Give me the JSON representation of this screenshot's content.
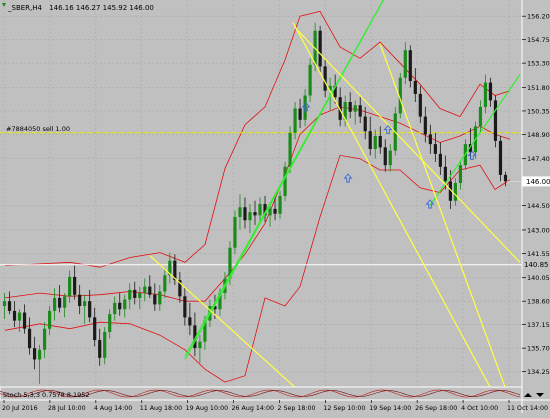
{
  "window": {
    "title": "_SBER,H4",
    "ohlc": "146.16 146.27 145.92 146.00"
  },
  "colors": {
    "background": "#c0c0c0",
    "grid": "#a9a9a9",
    "bull": "#1a8a1a",
    "bear": "#1a1a1a",
    "bollinger": "#e01010",
    "trend_yellow": "#ffff40",
    "trend_green": "#33ee33",
    "order_line": "#e8e800",
    "level_line": "#ffffff",
    "arrows": "#3a6ad6",
    "current_price_bg": "#ffffff"
  },
  "annotations": {
    "order_label": "#7884050 sell 1.00",
    "indicator_label": "Stoch 5,3,3 0.7578 8.1952"
  },
  "chart_data": {
    "type": "candlestick",
    "symbol": "_SBER",
    "timeframe": "H4",
    "ylim": [
      133.3,
      157.2
    ],
    "y_ticks": [
      {
        "value": 156.2,
        "label": "156.20"
      },
      {
        "value": 154.75,
        "label": "154.75"
      },
      {
        "value": 153.3,
        "label": "153.30"
      },
      {
        "value": 151.8,
        "label": "151.80"
      },
      {
        "value": 150.35,
        "label": "150.35"
      },
      {
        "value": 148.9,
        "label": "148.90"
      },
      {
        "value": 147.4,
        "label": "147.40"
      },
      {
        "value": 144.5,
        "label": "144.50"
      },
      {
        "value": 143.0,
        "label": "143.00"
      },
      {
        "value": 141.55,
        "label": "141.55"
      },
      {
        "value": 140.05,
        "label": "140.05"
      },
      {
        "value": 138.6,
        "label": "138.60"
      },
      {
        "value": 137.15,
        "label": "137.15"
      },
      {
        "value": 135.7,
        "label": "135.70"
      },
      {
        "value": 134.25,
        "label": "134.25"
      },
      {
        "value": 132.8,
        "label": "132.80"
      }
    ],
    "x_ticks": [
      "20 Jul 2016",
      "28 Jul 10:00",
      "4 Aug 14:00",
      "11 Aug 18:00",
      "19 Aug 10:00",
      "26 Aug 14:00",
      "2 Sep 18:00",
      "12 Sep 10:00",
      "19 Sep 14:00",
      "26 Sep 18:00",
      "4 Oct 10:00",
      "11 Oct 14:00"
    ],
    "current_price": {
      "value": 146.0,
      "label": "146.00"
    },
    "level_line": {
      "value": 140.85,
      "label": "140.85"
    },
    "order_line": {
      "value": 149.0
    },
    "bollinger": {
      "upper": [
        [
          5,
          140.8
        ],
        [
          40,
          140.9
        ],
        [
          70,
          141.0
        ],
        [
          100,
          140.7
        ],
        [
          130,
          141.3
        ],
        [
          160,
          141.6
        ],
        [
          185,
          141.0
        ],
        [
          205,
          142.1
        ],
        [
          225,
          146.8
        ],
        [
          245,
          149.5
        ],
        [
          265,
          150.6
        ],
        [
          285,
          153.5
        ],
        [
          300,
          156.2
        ],
        [
          320,
          156.5
        ],
        [
          340,
          154.3
        ],
        [
          360,
          153.6
        ],
        [
          380,
          154.6
        ],
        [
          400,
          153.3
        ],
        [
          420,
          152.0
        ],
        [
          440,
          150.5
        ],
        [
          460,
          150.0
        ],
        [
          480,
          152.0
        ],
        [
          495,
          151.3
        ],
        [
          510,
          151.6
        ]
      ],
      "middle": [
        [
          5,
          138.8
        ],
        [
          40,
          139.1
        ],
        [
          70,
          138.9
        ],
        [
          100,
          139.0
        ],
        [
          130,
          139.2
        ],
        [
          160,
          139.0
        ],
        [
          185,
          138.6
        ],
        [
          205,
          138.6
        ],
        [
          225,
          140.0
        ],
        [
          245,
          141.5
        ],
        [
          265,
          143.4
        ],
        [
          285,
          146.4
        ],
        [
          300,
          148.9
        ],
        [
          320,
          150.1
        ],
        [
          340,
          150.6
        ],
        [
          360,
          150.4
        ],
        [
          380,
          150.0
        ],
        [
          400,
          149.6
        ],
        [
          420,
          149.0
        ],
        [
          440,
          148.4
        ],
        [
          460,
          148.8
        ],
        [
          480,
          149.4
        ],
        [
          495,
          148.9
        ],
        [
          510,
          148.6
        ]
      ],
      "lower": [
        [
          5,
          136.8
        ],
        [
          40,
          137.2
        ],
        [
          70,
          136.9
        ],
        [
          100,
          137.3
        ],
        [
          130,
          137.2
        ],
        [
          160,
          136.5
        ],
        [
          185,
          135.6
        ],
        [
          205,
          134.4
        ],
        [
          225,
          133.6
        ],
        [
          245,
          134.0
        ],
        [
          265,
          138.8
        ],
        [
          285,
          138.3
        ],
        [
          300,
          139.5
        ],
        [
          320,
          143.8
        ],
        [
          340,
          147.6
        ],
        [
          360,
          147.4
        ],
        [
          380,
          146.7
        ],
        [
          400,
          146.7
        ],
        [
          420,
          145.6
        ],
        [
          440,
          145.3
        ],
        [
          460,
          146.7
        ],
        [
          480,
          147.0
        ],
        [
          495,
          145.5
        ],
        [
          510,
          146.1
        ]
      ]
    },
    "trendlines": [
      {
        "color": "green",
        "x1": 185,
        "y1": 135.2,
        "x2": 395,
        "y2": 158.5
      },
      {
        "color": "green",
        "x1": 185,
        "y1": 135.0,
        "x2": 395,
        "y2": 158.5
      },
      {
        "color": "green",
        "x1": 430,
        "y1": 144.5,
        "x2": 520,
        "y2": 152.6
      },
      {
        "color": "yellow",
        "x1": 150,
        "y1": 141.4,
        "x2": 300,
        "y2": 133.0
      },
      {
        "color": "yellow",
        "x1": 293,
        "y1": 155.8,
        "x2": 490,
        "y2": 133.3
      },
      {
        "color": "yellow",
        "x1": 295,
        "y1": 155.5,
        "x2": 520,
        "y2": 141.0
      },
      {
        "color": "yellow",
        "x1": 380,
        "y1": 154.5,
        "x2": 505,
        "y2": 133.3
      }
    ],
    "arrows": [
      {
        "x": 306,
        "y": 150.6
      },
      {
        "x": 348,
        "y": 146.2
      },
      {
        "x": 388,
        "y": 149.2
      },
      {
        "x": 430,
        "y": 144.6
      },
      {
        "x": 472,
        "y": 147.6
      }
    ],
    "candles": [
      {
        "o": 138.3,
        "h": 139.1,
        "l": 137.5,
        "c": 138.6
      },
      {
        "o": 138.6,
        "h": 139.2,
        "l": 137.8,
        "c": 138.0
      },
      {
        "o": 138.0,
        "h": 138.6,
        "l": 137.0,
        "c": 137.4
      },
      {
        "o": 137.4,
        "h": 138.1,
        "l": 136.7,
        "c": 137.9
      },
      {
        "o": 137.9,
        "h": 138.4,
        "l": 136.6,
        "c": 136.9
      },
      {
        "o": 136.9,
        "h": 137.6,
        "l": 135.3,
        "c": 135.7
      },
      {
        "o": 135.7,
        "h": 136.4,
        "l": 134.4,
        "c": 135.0
      },
      {
        "o": 135.0,
        "h": 135.9,
        "l": 133.5,
        "c": 135.6
      },
      {
        "o": 135.6,
        "h": 137.3,
        "l": 135.1,
        "c": 136.9
      },
      {
        "o": 136.9,
        "h": 138.3,
        "l": 136.5,
        "c": 138.0
      },
      {
        "o": 138.0,
        "h": 139.4,
        "l": 137.4,
        "c": 138.8
      },
      {
        "o": 138.8,
        "h": 139.6,
        "l": 137.9,
        "c": 138.2
      },
      {
        "o": 138.2,
        "h": 139.1,
        "l": 137.6,
        "c": 138.9
      },
      {
        "o": 138.9,
        "h": 140.5,
        "l": 138.5,
        "c": 140.1
      },
      {
        "o": 140.1,
        "h": 140.8,
        "l": 138.7,
        "c": 139.0
      },
      {
        "o": 139.0,
        "h": 139.6,
        "l": 137.8,
        "c": 138.3
      },
      {
        "o": 138.3,
        "h": 139.0,
        "l": 137.2,
        "c": 138.6
      },
      {
        "o": 138.6,
        "h": 139.3,
        "l": 137.3,
        "c": 137.6
      },
      {
        "o": 137.6,
        "h": 138.2,
        "l": 135.8,
        "c": 136.2
      },
      {
        "o": 136.2,
        "h": 136.9,
        "l": 134.6,
        "c": 135.1
      },
      {
        "o": 135.1,
        "h": 137.0,
        "l": 134.7,
        "c": 136.7
      },
      {
        "o": 136.7,
        "h": 138.1,
        "l": 136.3,
        "c": 137.8
      },
      {
        "o": 137.8,
        "h": 138.9,
        "l": 137.4,
        "c": 138.5
      },
      {
        "o": 138.5,
        "h": 139.1,
        "l": 137.7,
        "c": 138.1
      },
      {
        "o": 138.1,
        "h": 139.0,
        "l": 137.6,
        "c": 138.7
      },
      {
        "o": 138.7,
        "h": 139.7,
        "l": 138.1,
        "c": 139.3
      },
      {
        "o": 139.3,
        "h": 139.8,
        "l": 138.4,
        "c": 138.8
      },
      {
        "o": 138.8,
        "h": 139.5,
        "l": 138.1,
        "c": 139.1
      },
      {
        "o": 139.1,
        "h": 140.0,
        "l": 138.6,
        "c": 139.5
      },
      {
        "o": 139.5,
        "h": 140.2,
        "l": 138.8,
        "c": 139.0
      },
      {
        "o": 139.0,
        "h": 139.7,
        "l": 138.0,
        "c": 138.4
      },
      {
        "o": 138.4,
        "h": 139.6,
        "l": 138.0,
        "c": 139.2
      },
      {
        "o": 139.2,
        "h": 140.6,
        "l": 138.8,
        "c": 140.2
      },
      {
        "o": 140.2,
        "h": 141.6,
        "l": 139.7,
        "c": 141.1
      },
      {
        "o": 141.1,
        "h": 141.5,
        "l": 139.6,
        "c": 139.9
      },
      {
        "o": 139.9,
        "h": 140.4,
        "l": 138.5,
        "c": 138.9
      },
      {
        "o": 138.9,
        "h": 139.5,
        "l": 137.1,
        "c": 137.6
      },
      {
        "o": 137.6,
        "h": 138.5,
        "l": 136.5,
        "c": 137.1
      },
      {
        "o": 137.1,
        "h": 137.9,
        "l": 135.2,
        "c": 135.7
      },
      {
        "o": 135.7,
        "h": 136.5,
        "l": 134.8,
        "c": 136.1
      },
      {
        "o": 136.1,
        "h": 137.7,
        "l": 135.6,
        "c": 137.4
      },
      {
        "o": 137.4,
        "h": 138.7,
        "l": 137.0,
        "c": 138.3
      },
      {
        "o": 138.3,
        "h": 139.0,
        "l": 137.5,
        "c": 138.1
      },
      {
        "o": 138.1,
        "h": 139.4,
        "l": 137.7,
        "c": 139.1
      },
      {
        "o": 139.1,
        "h": 140.4,
        "l": 138.7,
        "c": 140.0
      },
      {
        "o": 140.0,
        "h": 142.3,
        "l": 139.6,
        "c": 141.9
      },
      {
        "o": 141.9,
        "h": 144.2,
        "l": 141.5,
        "c": 143.8
      },
      {
        "o": 143.8,
        "h": 145.2,
        "l": 143.0,
        "c": 144.4
      },
      {
        "o": 144.4,
        "h": 145.0,
        "l": 143.1,
        "c": 143.6
      },
      {
        "o": 143.6,
        "h": 144.6,
        "l": 142.8,
        "c": 144.1
      },
      {
        "o": 144.1,
        "h": 144.8,
        "l": 143.3,
        "c": 143.9
      },
      {
        "o": 143.9,
        "h": 145.0,
        "l": 143.4,
        "c": 144.6
      },
      {
        "o": 144.6,
        "h": 145.1,
        "l": 143.5,
        "c": 143.9
      },
      {
        "o": 143.9,
        "h": 144.7,
        "l": 143.2,
        "c": 144.3
      },
      {
        "o": 144.3,
        "h": 145.0,
        "l": 143.6,
        "c": 144.0
      },
      {
        "o": 144.0,
        "h": 145.4,
        "l": 143.7,
        "c": 145.1
      },
      {
        "o": 145.1,
        "h": 147.2,
        "l": 144.8,
        "c": 146.9
      },
      {
        "o": 146.9,
        "h": 149.4,
        "l": 146.5,
        "c": 149.0
      },
      {
        "o": 149.0,
        "h": 150.9,
        "l": 148.6,
        "c": 150.5
      },
      {
        "o": 150.5,
        "h": 151.1,
        "l": 149.3,
        "c": 149.8
      },
      {
        "o": 149.8,
        "h": 151.7,
        "l": 149.4,
        "c": 151.3
      },
      {
        "o": 151.3,
        "h": 153.6,
        "l": 150.9,
        "c": 153.2
      },
      {
        "o": 153.2,
        "h": 155.8,
        "l": 152.8,
        "c": 155.3
      },
      {
        "o": 155.3,
        "h": 155.6,
        "l": 152.7,
        "c": 153.1
      },
      {
        "o": 153.1,
        "h": 153.5,
        "l": 151.2,
        "c": 151.6
      },
      {
        "o": 151.6,
        "h": 152.4,
        "l": 150.4,
        "c": 151.9
      },
      {
        "o": 151.9,
        "h": 152.6,
        "l": 150.8,
        "c": 151.2
      },
      {
        "o": 151.2,
        "h": 151.8,
        "l": 149.4,
        "c": 149.8
      },
      {
        "o": 149.8,
        "h": 151.3,
        "l": 149.4,
        "c": 150.9
      },
      {
        "o": 150.9,
        "h": 151.5,
        "l": 149.9,
        "c": 150.3
      },
      {
        "o": 150.3,
        "h": 151.0,
        "l": 149.5,
        "c": 150.7
      },
      {
        "o": 150.7,
        "h": 151.2,
        "l": 149.6,
        "c": 150.0
      },
      {
        "o": 150.0,
        "h": 150.6,
        "l": 148.6,
        "c": 149.1
      },
      {
        "o": 149.1,
        "h": 150.0,
        "l": 147.6,
        "c": 148.0
      },
      {
        "o": 148.0,
        "h": 149.2,
        "l": 147.4,
        "c": 148.8
      },
      {
        "o": 148.8,
        "h": 149.4,
        "l": 147.7,
        "c": 148.1
      },
      {
        "o": 148.1,
        "h": 148.6,
        "l": 146.6,
        "c": 147.0
      },
      {
        "o": 147.0,
        "h": 148.3,
        "l": 146.6,
        "c": 147.9
      },
      {
        "o": 147.9,
        "h": 150.6,
        "l": 147.6,
        "c": 150.2
      },
      {
        "o": 150.2,
        "h": 152.7,
        "l": 149.9,
        "c": 152.4
      },
      {
        "o": 152.4,
        "h": 154.6,
        "l": 152.0,
        "c": 154.1
      },
      {
        "o": 154.1,
        "h": 154.4,
        "l": 151.8,
        "c": 152.2
      },
      {
        "o": 152.2,
        "h": 153.0,
        "l": 150.9,
        "c": 151.4
      },
      {
        "o": 151.4,
        "h": 151.9,
        "l": 149.6,
        "c": 150.0
      },
      {
        "o": 150.0,
        "h": 150.6,
        "l": 148.4,
        "c": 148.9
      },
      {
        "o": 148.9,
        "h": 149.5,
        "l": 147.7,
        "c": 148.3
      },
      {
        "o": 148.3,
        "h": 149.0,
        "l": 147.2,
        "c": 147.7
      },
      {
        "o": 147.7,
        "h": 148.4,
        "l": 146.4,
        "c": 146.9
      },
      {
        "o": 146.9,
        "h": 147.6,
        "l": 145.5,
        "c": 146.0
      },
      {
        "o": 146.0,
        "h": 146.7,
        "l": 144.3,
        "c": 144.8
      },
      {
        "o": 144.8,
        "h": 146.2,
        "l": 144.5,
        "c": 145.9
      },
      {
        "o": 145.9,
        "h": 147.3,
        "l": 145.5,
        "c": 147.0
      },
      {
        "o": 147.0,
        "h": 148.6,
        "l": 146.7,
        "c": 148.3
      },
      {
        "o": 148.3,
        "h": 149.3,
        "l": 147.4,
        "c": 147.8
      },
      {
        "o": 147.8,
        "h": 149.7,
        "l": 147.4,
        "c": 149.4
      },
      {
        "o": 149.4,
        "h": 151.0,
        "l": 149.0,
        "c": 150.6
      },
      {
        "o": 150.6,
        "h": 152.6,
        "l": 150.2,
        "c": 152.1
      },
      {
        "o": 152.1,
        "h": 152.4,
        "l": 150.6,
        "c": 151.0
      },
      {
        "o": 151.0,
        "h": 151.3,
        "l": 148.1,
        "c": 148.5
      },
      {
        "o": 148.5,
        "h": 148.8,
        "l": 146.0,
        "c": 146.4
      },
      {
        "o": 146.4,
        "h": 146.6,
        "l": 145.7,
        "c": 146.0
      }
    ]
  }
}
